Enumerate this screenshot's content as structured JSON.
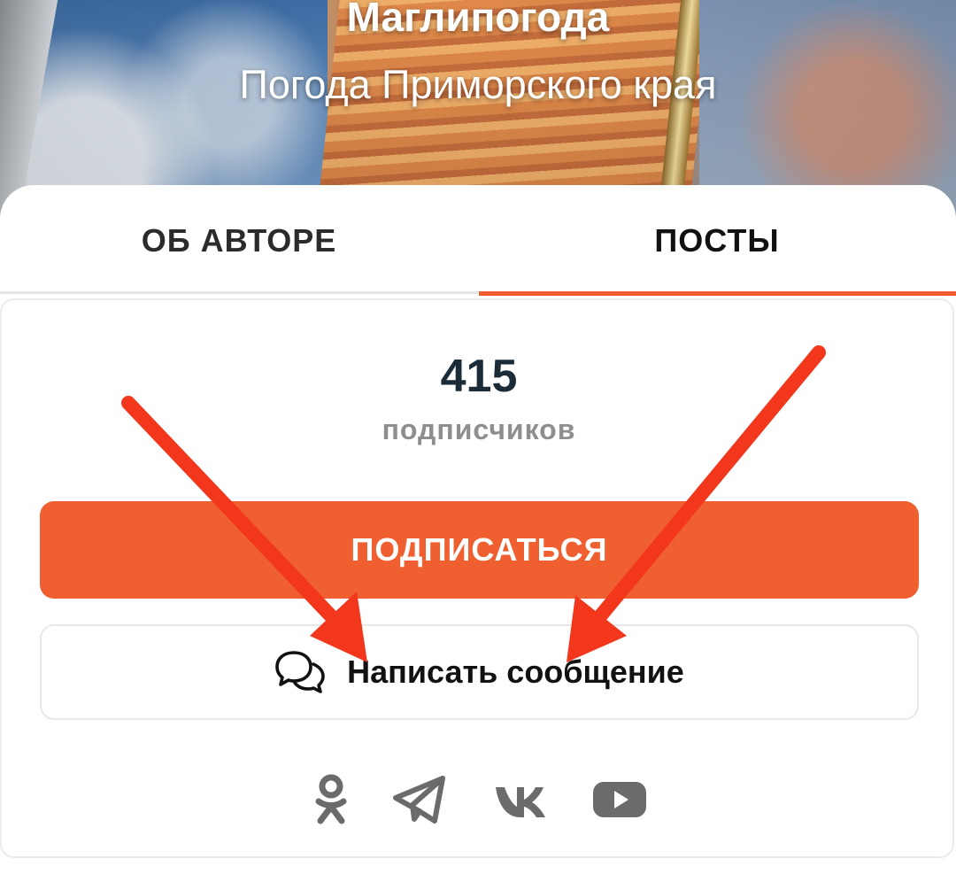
{
  "header": {
    "channel_name": "Маглипогода",
    "description": "Погода Приморского края"
  },
  "tabs": [
    {
      "label": "ОБ АВТОРЕ",
      "active": false
    },
    {
      "label": "ПОСТЫ",
      "active": true
    }
  ],
  "stats": {
    "subscribers_count": "415",
    "subscribers_label": "подписчиков"
  },
  "actions": {
    "subscribe_label": "ПОДПИСАТЬСЯ",
    "message_label": "Написать сообщение",
    "message_icon": "chat-bubbles-icon"
  },
  "socials": [
    {
      "name": "odnoklassniki-icon"
    },
    {
      "name": "telegram-icon"
    },
    {
      "name": "vk-icon"
    },
    {
      "name": "youtube-icon"
    }
  ],
  "colors": {
    "accent": "#f05f2f",
    "arrow": "#f2371c",
    "tab_indicator": "#f05a2c",
    "social_icon": "#6b6b6b"
  }
}
